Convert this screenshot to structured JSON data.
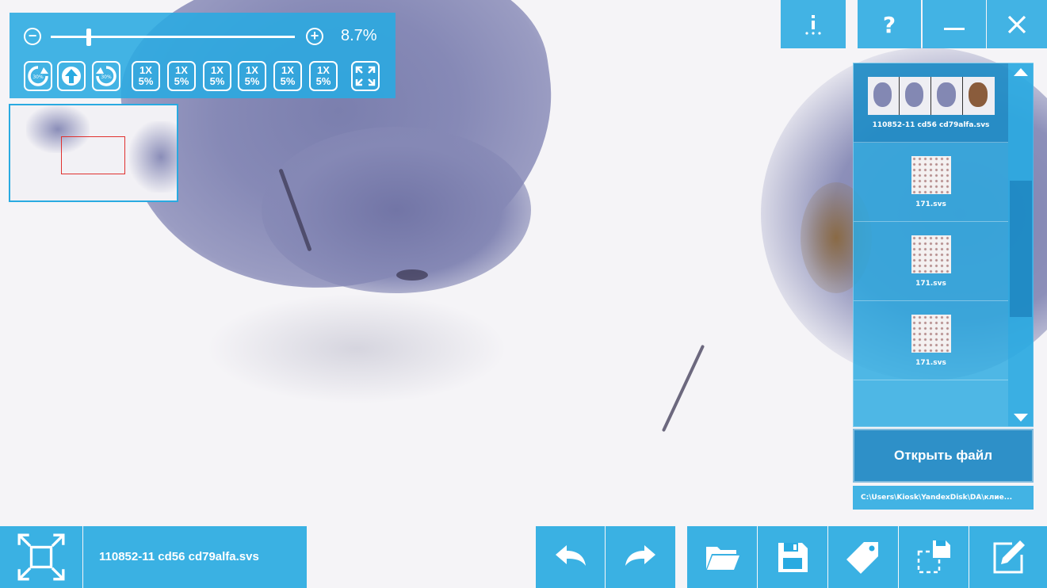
{
  "zoom": {
    "value_label": "8.7%",
    "level_fraction": 0.155,
    "minus_icon": "zoom-out-icon",
    "plus_icon": "zoom-in-icon"
  },
  "toolbar": {
    "rotate_left_label": "30%",
    "rotate_right_label": "30%",
    "scale_buttons": [
      {
        "top": "1X",
        "bottom": "5%"
      },
      {
        "top": "1X",
        "bottom": "5%"
      },
      {
        "top": "1X",
        "bottom": "5%"
      },
      {
        "top": "1X",
        "bottom": "5%"
      },
      {
        "top": "1X",
        "bottom": "5%"
      },
      {
        "top": "1X",
        "bottom": "5%"
      }
    ]
  },
  "window_buttons": [
    "info-icon",
    "help-icon",
    "minimize-icon",
    "close-icon"
  ],
  "file_list": {
    "items": [
      {
        "name": "110852-11 cd56 cd79alfa.svs",
        "selected": true
      },
      {
        "name": "171.svs",
        "selected": false
      },
      {
        "name": "171.svs",
        "selected": false
      },
      {
        "name": "171.svs",
        "selected": false
      }
    ]
  },
  "open_file_label": "Открыть файл",
  "path": "C:\\Users\\Kiosk\\YandexDisk\\DA\\клие...",
  "current_file": "110852-11 cd56 cd79alfa.svs",
  "colors": {
    "accent": "#29aae1",
    "minimap_viewport": "#e0312f"
  }
}
